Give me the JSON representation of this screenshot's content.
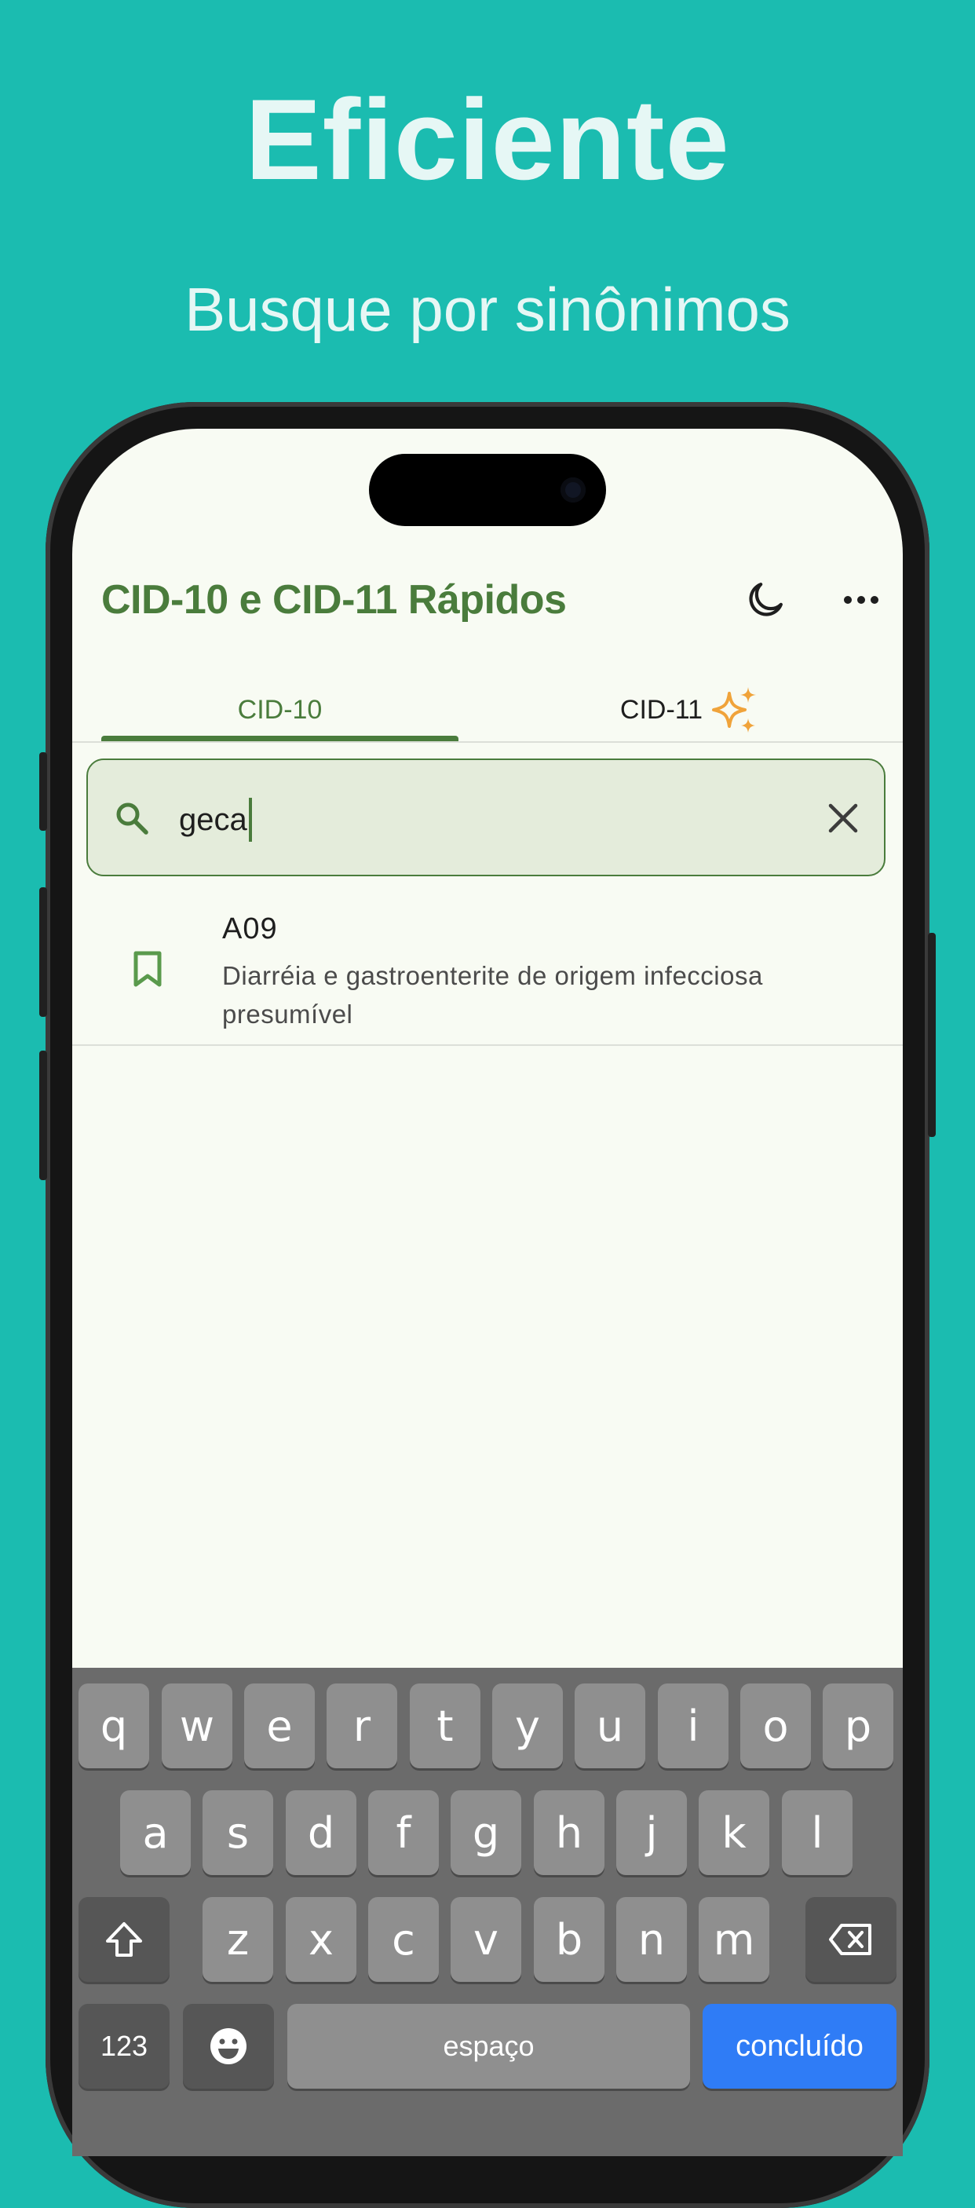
{
  "promo": {
    "headline": "Eficiente",
    "subheadline": "Busque por sinônimos"
  },
  "colors": {
    "background": "#1bbcb0",
    "accent": "#4a7c3c",
    "sparkle": "#f0a33a",
    "keyboard_return": "#2f7cf6"
  },
  "app": {
    "title": "CID-10 e CID-11 Rápidos",
    "tabs": [
      {
        "label": "CID-10",
        "selected": true
      },
      {
        "label": "CID-11",
        "selected": false
      }
    ]
  },
  "search": {
    "value": "geca"
  },
  "results": [
    {
      "code": "A09",
      "description": "Diarréia e gastroenterite de origem infecciosa presumível"
    }
  ],
  "keyboard": {
    "row1": [
      "q",
      "w",
      "e",
      "r",
      "t",
      "y",
      "u",
      "i",
      "o",
      "p"
    ],
    "row2": [
      "a",
      "s",
      "d",
      "f",
      "g",
      "h",
      "j",
      "k",
      "l"
    ],
    "row3": [
      "z",
      "x",
      "c",
      "v",
      "b",
      "n",
      "m"
    ],
    "numbers_label": "123",
    "space_label": "espaço",
    "return_label": "concluído"
  }
}
